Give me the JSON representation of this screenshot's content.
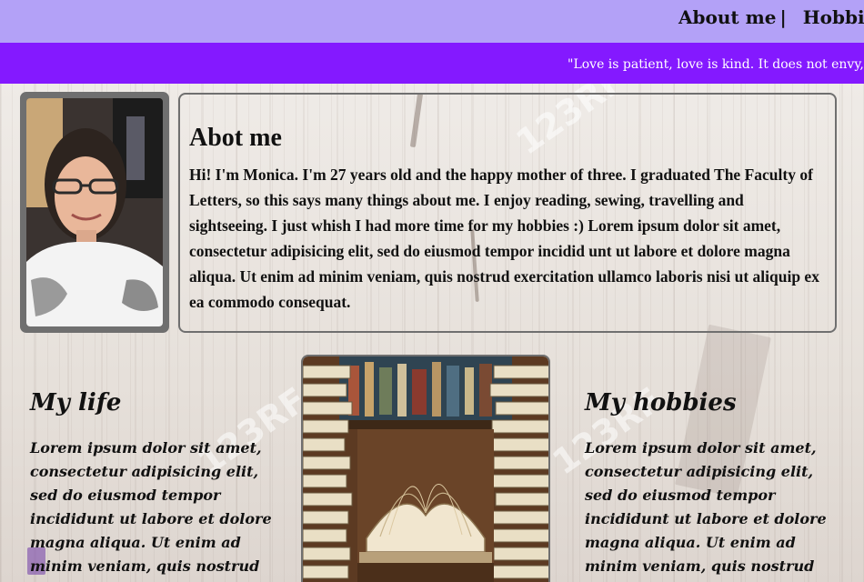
{
  "nav": {
    "items": [
      {
        "label": "About me",
        "sep": "|"
      },
      {
        "label": "Hobbies",
        "sep": "|"
      }
    ]
  },
  "quote": "\"Love is patient, love is kind. It does not envy, it do",
  "about": {
    "title": "Abot me",
    "text": "Hi! I'm Monica. I'm 27 years old and the happy mother of three. I graduated The Faculty of Letters, so this says many things about me. I enjoy reading, sewing, travelling and sightseeing. I just whish I had more time for my hobbies :) Lorem ipsum dolor sit amet, consectetur adipisicing elit, sed do eiusmod tempor incidid unt ut labore et dolore magna aliqua. Ut enim ad minim veniam, quis nostrud exercitation ullamco laboris nisi ut aliquip ex ea commodo consequat."
  },
  "life": {
    "title": "My life",
    "text": "Lorem ipsum dolor sit amet, consectetur adipisicing elit, sed do eiusmod tempor incididunt ut labore et dolore magna aliqua.  Ut enim ad minim veniam, quis nostrud"
  },
  "hobbies": {
    "title": "My hobbies",
    "text": "Lorem ipsum dolor sit amet, consectetur adipisicing elit, sed do eiusmod tempor incididunt ut labore et dolore magna aliqua. Ut enim ad minim veniam, quis nostrud"
  },
  "watermark": "123RF",
  "colors": {
    "nav_bg": "#b3a1f7",
    "quote_bg": "#8419ff",
    "frame": "#6f6f6f"
  }
}
